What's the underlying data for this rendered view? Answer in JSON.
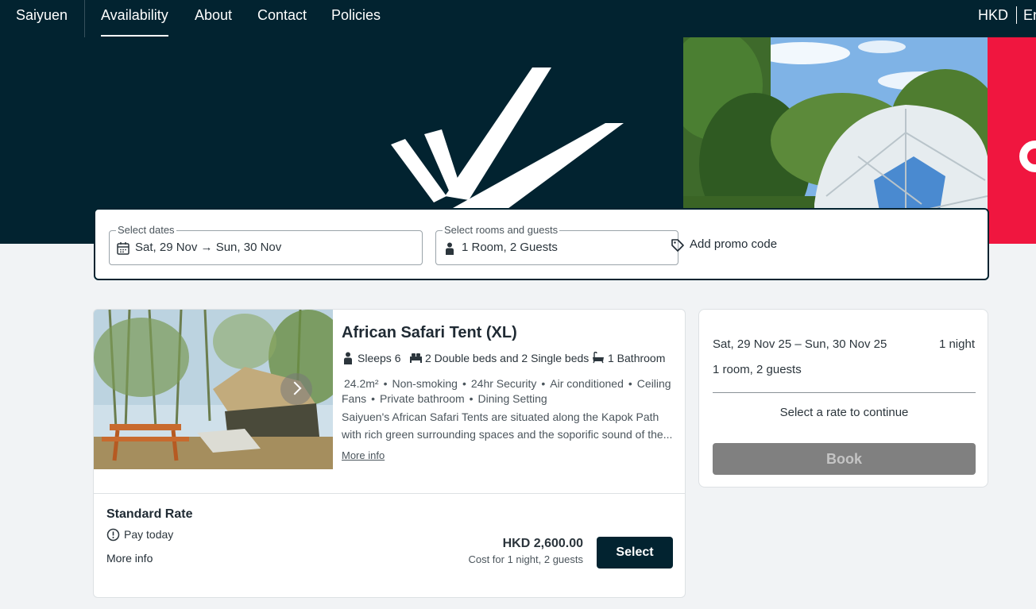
{
  "nav": {
    "brand": "Saiyuen",
    "links": [
      "Availability",
      "About",
      "Contact",
      "Policies"
    ],
    "currency": "HKD",
    "language": "En"
  },
  "search": {
    "dates_label": "Select dates",
    "dates_value": "Sat, 29 Nov → Sun, 30 Nov",
    "rooms_label": "Select rooms and guests",
    "rooms_value": "1 Room, 2 Guests",
    "promo": "Add promo code"
  },
  "room": {
    "title": "African Safari Tent (XL)",
    "sleeps": "Sleeps 6",
    "beds": "2 Double beds and 2 Single beds",
    "bathroom": "1 Bathroom",
    "amenities": [
      "24.2m²",
      "Non-smoking",
      "24hr Security",
      "Air conditioned",
      "Ceiling Fans",
      "Private bathroom",
      "Dining Setting"
    ],
    "description": "Saiyuen's African Safari Tents are situated along the Kapok Path with rich green surrounding spaces and the soporific sound of the...",
    "more_info": "More info",
    "rate": {
      "name": "Standard Rate",
      "pay": "Pay today",
      "more_info": "More info",
      "price": "HKD 2,600.00",
      "price_note": "Cost for 1 night, 2 guests",
      "select": "Select"
    }
  },
  "summary": {
    "dates": "Sat, 29 Nov 25 – Sun, 30 Nov 25",
    "nights": "1 night",
    "guests": "1 room, 2 guests",
    "prompt": "Select a rate to continue",
    "book": "Book"
  },
  "colors": {
    "brand_dark": "#022330",
    "accent_red": "#f0163f",
    "background": "#f1f3f5"
  },
  "icons": [
    "calendar-icon",
    "person-icon",
    "tag-icon",
    "bed-icon",
    "bathtub-icon",
    "info-circle-icon",
    "chevron-right-icon"
  ]
}
